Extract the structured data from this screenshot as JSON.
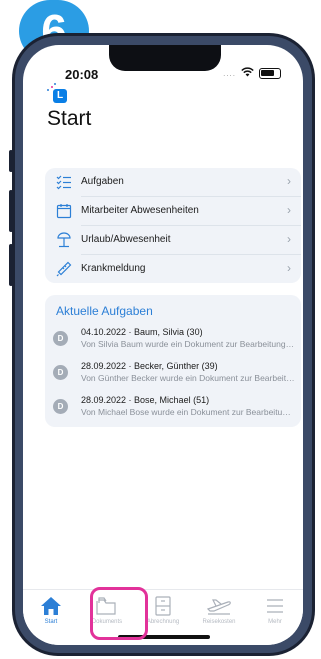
{
  "step": {
    "number": "6"
  },
  "status_bar": {
    "time": "20:08"
  },
  "header": {
    "title": "Start",
    "logo_letter": "L"
  },
  "menu": {
    "items": [
      {
        "label": "Aufgaben",
        "icon": "checklist-icon"
      },
      {
        "label": "Mitarbeiter Abwesenheiten",
        "icon": "calendar-icon"
      },
      {
        "label": "Urlaub/Abwesenheit",
        "icon": "beach-umbrella-icon"
      },
      {
        "label": "Krankmeldung",
        "icon": "thermometer-icon"
      }
    ]
  },
  "tasks": {
    "title": "Aktuelle Aufgaben",
    "items": [
      {
        "badge": "D",
        "title": "04.10.2022 · Baum, Silvia (30)",
        "subtitle": "Von Silvia Baum wurde ein Dokument zur Bearbeitung bereitgestellt"
      },
      {
        "badge": "D",
        "title": "28.09.2022 · Becker, Günther (39)",
        "subtitle": "Von Günther Becker wurde ein Dokument zur Bearbeitung bereitgestellt"
      },
      {
        "badge": "D",
        "title": "28.09.2022 · Bose, Michael (51)",
        "subtitle": "Von Michael Bose wurde ein Dokument zur Bearbeitung bereitgestellt"
      }
    ]
  },
  "tabbar": {
    "tabs": [
      {
        "label": "Start",
        "icon": "home-icon",
        "active": true
      },
      {
        "label": "Dokuments",
        "icon": "folder-icon",
        "active": false,
        "highlighted": true
      },
      {
        "label": "Abrechnung",
        "icon": "cabinet-icon",
        "active": false
      },
      {
        "label": "Reisekosten",
        "icon": "airplane-icon",
        "active": false
      },
      {
        "label": "Mehr",
        "icon": "menu-icon",
        "active": false
      }
    ]
  },
  "colors": {
    "accent": "#2c7fd6",
    "step_badge": "#2b9de4",
    "highlight": "#e2329a"
  }
}
